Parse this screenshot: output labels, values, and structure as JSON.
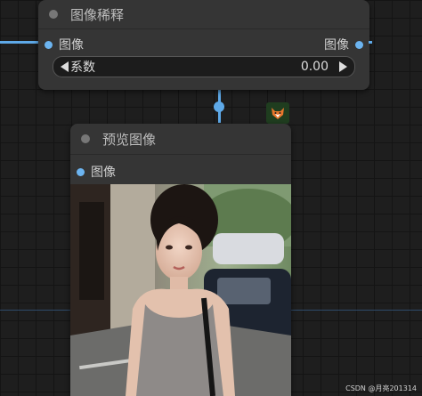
{
  "node_dilute": {
    "title": "图像稀释",
    "input_label": "图像",
    "output_label": "图像",
    "widget_label": "系数",
    "widget_value": "0.00"
  },
  "node_preview": {
    "title": "预览图像",
    "input_label": "图像"
  },
  "badge_icon": "fox-icon",
  "watermark": "CSDN @月亮201314",
  "colors": {
    "wire": "#5ea9e8",
    "node_bg": "#353535",
    "canvas": "#1e1e1e"
  }
}
